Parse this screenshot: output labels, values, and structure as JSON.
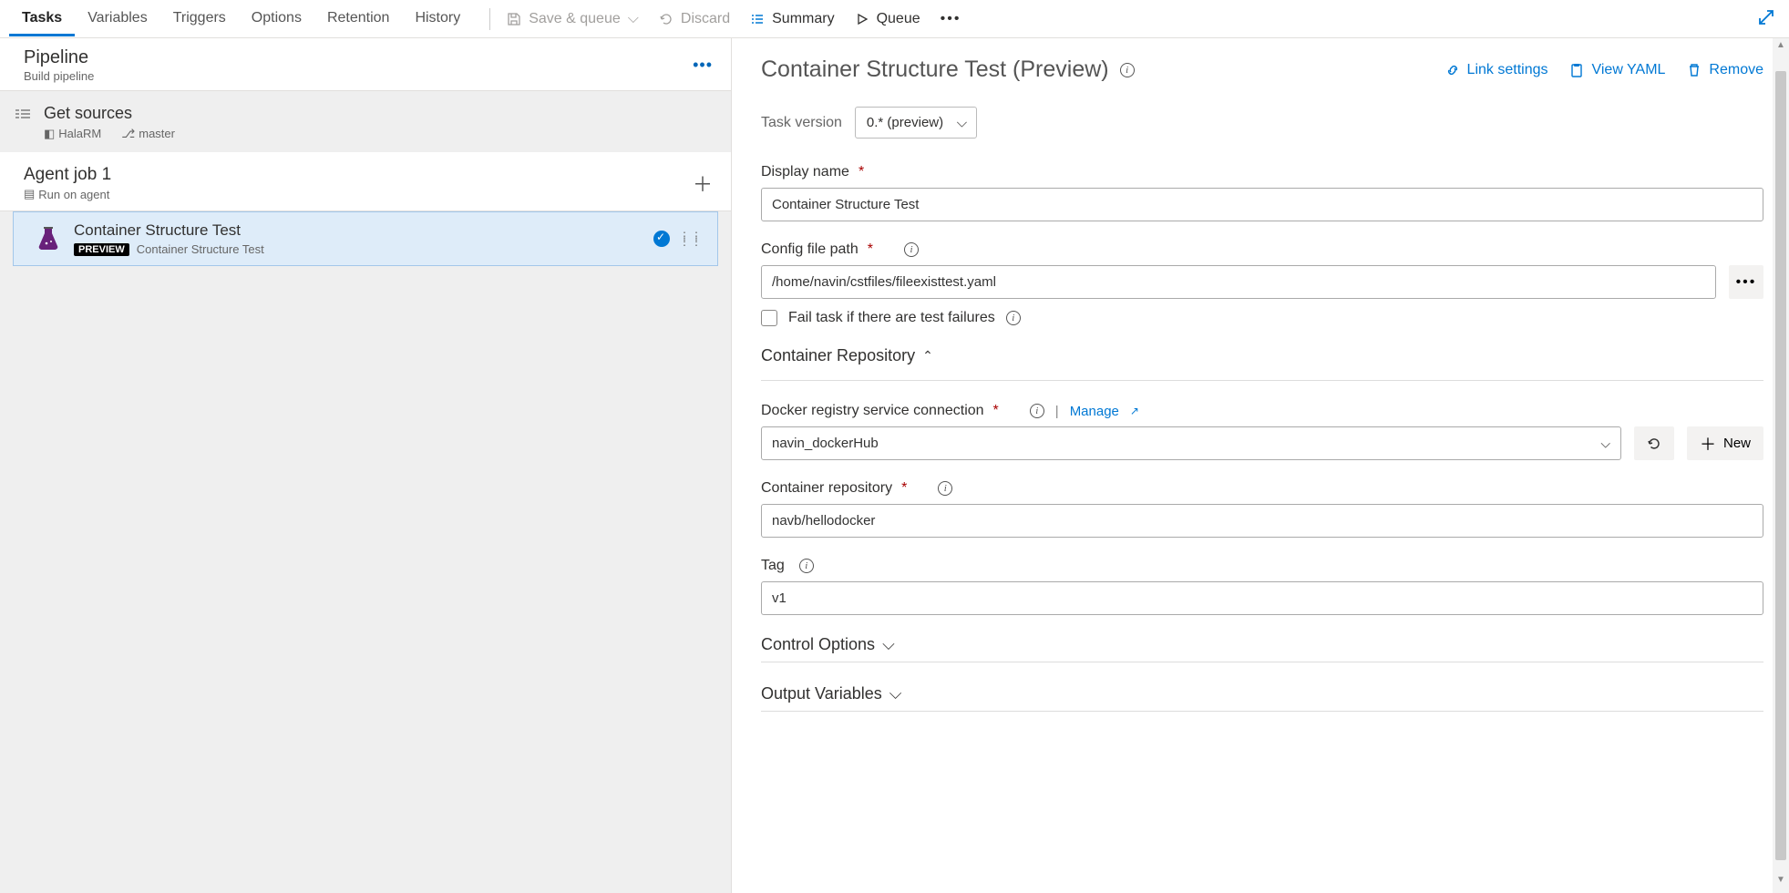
{
  "tabs": [
    "Tasks",
    "Variables",
    "Triggers",
    "Options",
    "Retention",
    "History"
  ],
  "active_tab": 0,
  "toolbar": {
    "save_queue": "Save & queue",
    "discard": "Discard",
    "summary": "Summary",
    "queue": "Queue"
  },
  "left": {
    "pipeline_title": "Pipeline",
    "pipeline_sub": "Build pipeline",
    "get_sources": "Get sources",
    "repo_name": "HalaRM",
    "branch": "master",
    "agent_title": "Agent job 1",
    "agent_sub": "Run on agent",
    "task_name": "Container Structure Test",
    "preview_badge": "PREVIEW",
    "task_sub": "Container Structure Test"
  },
  "detail": {
    "title": "Container Structure Test (Preview)",
    "links": {
      "link_settings": "Link settings",
      "view_yaml": "View YAML",
      "remove": "Remove"
    },
    "task_version_label": "Task version",
    "task_version_value": "0.* (preview)",
    "display_name_label": "Display name",
    "display_name_value": "Container Structure Test",
    "config_label": "Config file path",
    "config_value": "/home/navin/cstfiles/fileexisttest.yaml",
    "fail_checkbox": "Fail task if there are test failures",
    "section_repo": "Container Repository",
    "docker_conn_label": "Docker registry service connection",
    "manage_link": "Manage",
    "docker_conn_value": "navin_dockerHub",
    "new_btn": "New",
    "container_repo_label": "Container repository",
    "container_repo_value": "navb/hellodocker",
    "tag_label": "Tag",
    "tag_value": "v1",
    "control_options": "Control Options",
    "output_vars": "Output Variables"
  }
}
